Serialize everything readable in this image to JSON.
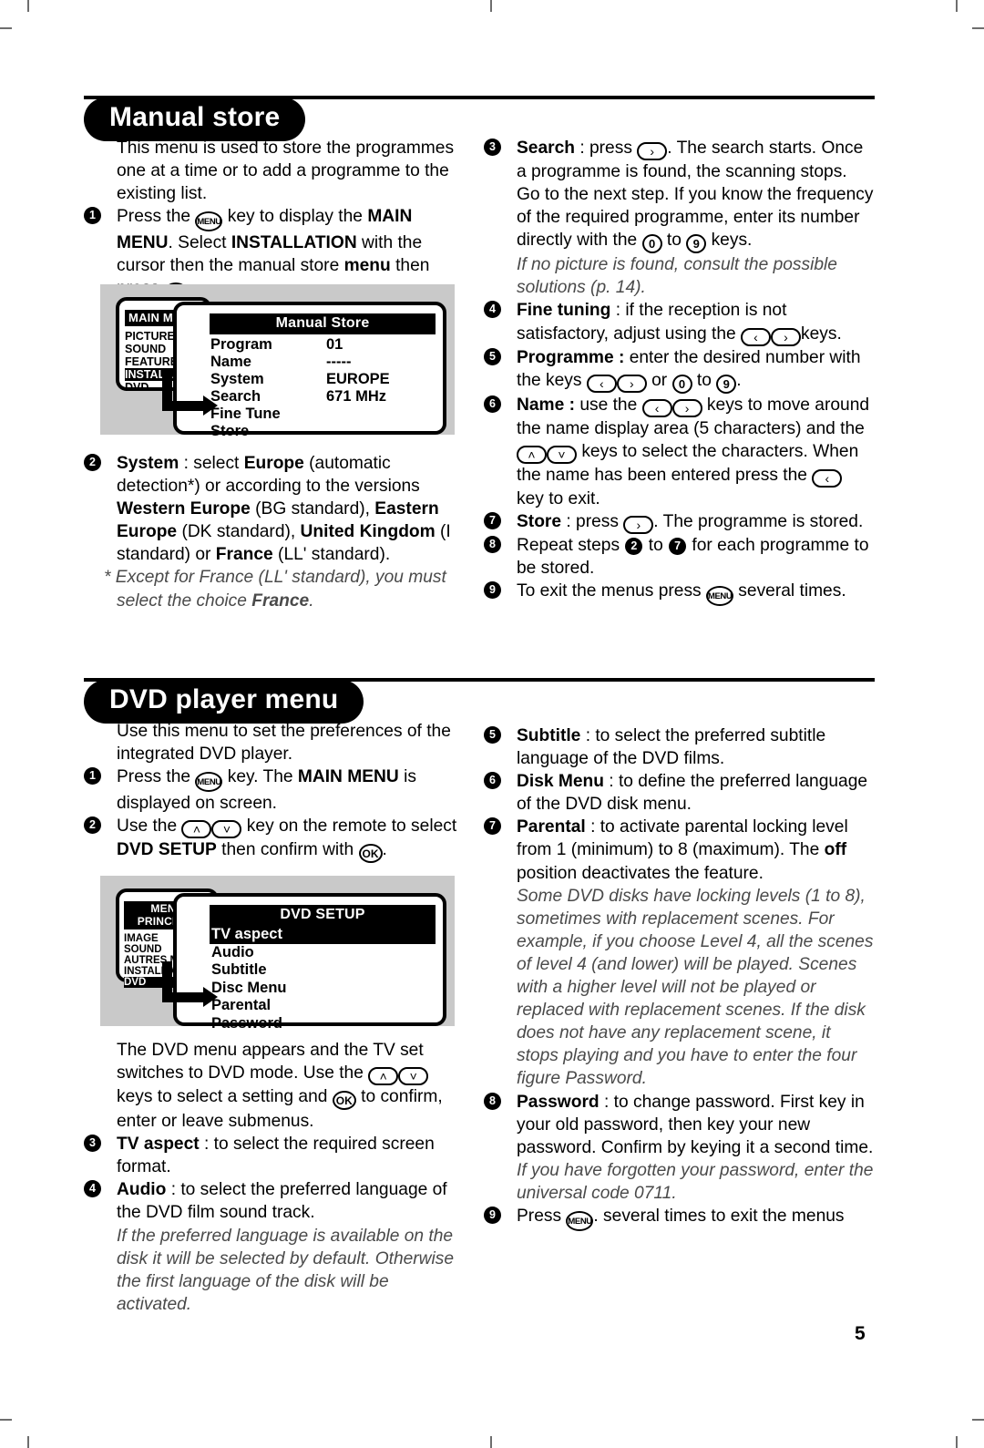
{
  "page": {
    "number": "5"
  },
  "sections": [
    {
      "id": "manual-store",
      "title": "Manual store",
      "left_column": {
        "intro": "This menu is used to store the programmes one at a time or to add a programme to the existing list.",
        "steps": [
          {
            "num": "1",
            "parts": [
              {
                "t": "Press the ",
                "s": "plain"
              },
              {
                "t": "MENU",
                "s": "key-menu"
              },
              {
                "t": " key to display the ",
                "s": "plain"
              },
              {
                "t": "MAIN MENU",
                "s": "bold"
              },
              {
                "t": ". Select ",
                "s": "plain"
              },
              {
                "t": "INSTALLATION",
                "s": "bold"
              },
              {
                "t": " with the cursor then the manual store ",
                "s": "plain"
              },
              {
                "t": "menu",
                "s": "bold"
              },
              {
                "t": " then press ",
                "s": "plain"
              },
              {
                "t": "OK",
                "s": "key-ok"
              },
              {
                "t": ".",
                "s": "plain"
              }
            ]
          },
          {
            "num": "2",
            "parts": [
              {
                "t": "System",
                "s": "bold"
              },
              {
                "t": " : select ",
                "s": "plain"
              },
              {
                "t": "Europe",
                "s": "bold"
              },
              {
                "t": " (automatic detection*) or according to the versions ",
                "s": "plain"
              },
              {
                "t": "Western Europe",
                "s": "bold"
              },
              {
                "t": " (BG standard), ",
                "s": "plain"
              },
              {
                "t": "Eastern Europe",
                "s": "bold"
              },
              {
                "t": " (DK standard), ",
                "s": "plain"
              },
              {
                "t": "United Kingdom",
                "s": "bold"
              },
              {
                "t": " (I standard) or ",
                "s": "plain"
              },
              {
                "t": "France",
                "s": "bold"
              },
              {
                "t": " (LL' standard).",
                "s": "plain"
              }
            ]
          }
        ],
        "footnote_parts": [
          {
            "t": "* Except for France (LL' standard), you must select the choice ",
            "s": "italic"
          },
          {
            "t": "France",
            "s": "italic-bold"
          },
          {
            "t": ".",
            "s": "italic"
          }
        ]
      },
      "right_column": {
        "steps": [
          {
            "num": "3",
            "parts": [
              {
                "t": "Search",
                "s": "bold"
              },
              {
                "t": " : press ",
                "s": "plain"
              },
              {
                "t": "›",
                "s": "key-right"
              },
              {
                "t": ". The search starts. Once a programme is found, the scanning stops. Go to the next step. If you know the frequency of the required programme, enter its number directly with the ",
                "s": "plain"
              },
              {
                "t": "0",
                "s": "key-num"
              },
              {
                "t": " to ",
                "s": "plain"
              },
              {
                "t": "9",
                "s": "key-num"
              },
              {
                "t": " keys.",
                "s": "plain"
              }
            ],
            "note": "If no picture is found, consult the possible solutions (p. 14)."
          },
          {
            "num": "4",
            "parts": [
              {
                "t": "Fine tuning",
                "s": "bold"
              },
              {
                "t": " : if the reception is not satisfactory, adjust using the ",
                "s": "plain"
              },
              {
                "t": "‹›",
                "s": "key-lr"
              },
              {
                "t": "keys.",
                "s": "plain"
              }
            ]
          },
          {
            "num": "5",
            "parts": [
              {
                "t": "Programme :",
                "s": "bold"
              },
              {
                "t": " enter the desired number with the keys ",
                "s": "plain"
              },
              {
                "t": "‹›",
                "s": "key-lr"
              },
              {
                "t": " or ",
                "s": "plain"
              },
              {
                "t": "0",
                "s": "key-num"
              },
              {
                "t": " to ",
                "s": "plain"
              },
              {
                "t": "9",
                "s": "key-num"
              },
              {
                "t": ".",
                "s": "plain"
              }
            ]
          },
          {
            "num": "6",
            "parts": [
              {
                "t": "Name :",
                "s": "bold"
              },
              {
                "t": " use the ",
                "s": "plain"
              },
              {
                "t": "‹›",
                "s": "key-lr"
              },
              {
                "t": " keys to move around the name display area (5 characters) and the ",
                "s": "plain"
              },
              {
                "t": "‸‹",
                "s": "key-ud"
              },
              {
                "t": " keys to select the characters. When the name has been entered press the ",
                "s": "plain"
              },
              {
                "t": "‹",
                "s": "key-left"
              },
              {
                "t": " key to exit.",
                "s": "plain"
              }
            ]
          },
          {
            "num": "7",
            "parts": [
              {
                "t": "Store",
                "s": "bold"
              },
              {
                "t": " : press ",
                "s": "plain"
              },
              {
                "t": "›",
                "s": "key-right"
              },
              {
                "t": ". The programme is stored.",
                "s": "plain"
              }
            ]
          },
          {
            "num": "8",
            "parts": [
              {
                "t": "Repeat steps ",
                "s": "plain"
              },
              {
                "t": "2",
                "s": "numdot"
              },
              {
                "t": " to ",
                "s": "plain"
              },
              {
                "t": "7",
                "s": "numdot"
              },
              {
                "t": " for each programme to be stored.",
                "s": "plain"
              }
            ]
          },
          {
            "num": "9",
            "parts": [
              {
                "t": "To exit the menus press ",
                "s": "plain"
              },
              {
                "t": "MENU",
                "s": "key-menu"
              },
              {
                "t": " several times.",
                "s": "plain"
              }
            ]
          }
        ]
      },
      "diagram": {
        "main_menu": {
          "title": "MAIN MENU",
          "items": [
            "PICTURE",
            "SOUND",
            "FEATURES",
            "INSTALLATION",
            "DVD"
          ],
          "selected": "INSTALLATION"
        },
        "sub_menu": {
          "title": "Manual Store",
          "rows": [
            {
              "label": "Program",
              "value": "01"
            },
            {
              "label": "Name",
              "value": "-----"
            },
            {
              "label": "System",
              "value": "EUROPE"
            },
            {
              "label": "Search",
              "value": "671 MHz"
            },
            {
              "label": "Fine Tune",
              "value": ""
            },
            {
              "label": "Store",
              "value": ""
            }
          ]
        }
      }
    },
    {
      "id": "dvd-player-menu",
      "title": "DVD player menu",
      "left_column": {
        "intro": "Use this menu to set the preferences of the integrated DVD player.",
        "steps": [
          {
            "num": "1",
            "parts": [
              {
                "t": "Press the ",
                "s": "plain"
              },
              {
                "t": "MENU",
                "s": "key-menu"
              },
              {
                "t": " key. The ",
                "s": "plain"
              },
              {
                "t": "MAIN MENU",
                "s": "bold"
              },
              {
                "t": " is displayed on screen.",
                "s": "plain"
              }
            ]
          },
          {
            "num": "2",
            "parts": [
              {
                "t": "Use the ",
                "s": "plain"
              },
              {
                "t": "‸‹",
                "s": "key-ud"
              },
              {
                "t": " key on the remote to select ",
                "s": "plain"
              },
              {
                "t": "DVD SETUP",
                "s": "bold"
              },
              {
                "t": " then confirm with ",
                "s": "plain"
              },
              {
                "t": "OK",
                "s": "key-ok"
              },
              {
                "t": ".",
                "s": "plain"
              }
            ]
          }
        ],
        "after_diagram_parts": [
          {
            "t": "The DVD menu appears and the TV set switches to DVD mode. Use the ",
            "s": "plain"
          },
          {
            "t": "‸‹",
            "s": "key-ud"
          },
          {
            "t": " keys to select a setting and ",
            "s": "plain"
          },
          {
            "t": "OK",
            "s": "key-ok"
          },
          {
            "t": " to confirm, enter or leave submenus.",
            "s": "plain"
          }
        ],
        "steps2": [
          {
            "num": "3",
            "parts": [
              {
                "t": "TV aspect",
                "s": "bold"
              },
              {
                "t": " : to select the required screen format.",
                "s": "plain"
              }
            ]
          },
          {
            "num": "4",
            "parts": [
              {
                "t": "Audio",
                "s": "bold"
              },
              {
                "t": " : to select the preferred language of the DVD film sound track.",
                "s": "plain"
              }
            ],
            "note": "If the preferred language is available on the disk it will be selected by default. Otherwise the first language of the disk will be activated."
          }
        ]
      },
      "right_column": {
        "steps": [
          {
            "num": "5",
            "parts": [
              {
                "t": "Subtitle",
                "s": "bold"
              },
              {
                "t": " : to select the preferred subtitle language of the DVD films.",
                "s": "plain"
              }
            ]
          },
          {
            "num": "6",
            "parts": [
              {
                "t": "Disk Menu",
                "s": "bold"
              },
              {
                "t": " : to define the preferred language of the DVD disk menu.",
                "s": "plain"
              }
            ]
          },
          {
            "num": "7",
            "parts": [
              {
                "t": "Parental",
                "s": "bold"
              },
              {
                "t": " : to activate parental locking level from 1 (minimum) to 8 (maximum). The ",
                "s": "plain"
              },
              {
                "t": "off",
                "s": "bold"
              },
              {
                "t": " position deactivates the feature.",
                "s": "plain"
              }
            ],
            "note": "Some DVD disks have locking levels (1 to 8), sometimes with replacement scenes. For example, if you choose Level 4, all the scenes of level 4 (and lower) will be played. Scenes with a higher level will not be played or replaced with replacement scenes. If the disk does not have any replacement scene, it stops playing and you have to enter the four figure Password."
          },
          {
            "num": "8",
            "parts": [
              {
                "t": "Password",
                "s": "bold"
              },
              {
                "t": " : to change password. First key in your old password, then key your new password. Confirm by keying it a second time.",
                "s": "plain"
              }
            ],
            "note": "If you have forgotten your password, enter the universal code 0711."
          },
          {
            "num": "9",
            "parts": [
              {
                "t": "Press ",
                "s": "plain"
              },
              {
                "t": "MENU",
                "s": "key-menu"
              },
              {
                "t": ". several times to exit the menus",
                "s": "plain"
              }
            ]
          }
        ]
      },
      "diagram": {
        "main_menu": {
          "title": "MENU PRINCIPAL",
          "items": [
            "IMAGE",
            "SOUND",
            "AUTRES MENUS",
            "INSTALLATION",
            "DVD"
          ],
          "selected": "DVD"
        },
        "sub_menu": {
          "title": "DVD SETUP",
          "items": [
            "TV aspect",
            "Audio",
            "Subtitle",
            "Disc Menu",
            "Parental",
            "Password"
          ],
          "selected": "TV aspect"
        }
      }
    }
  ]
}
